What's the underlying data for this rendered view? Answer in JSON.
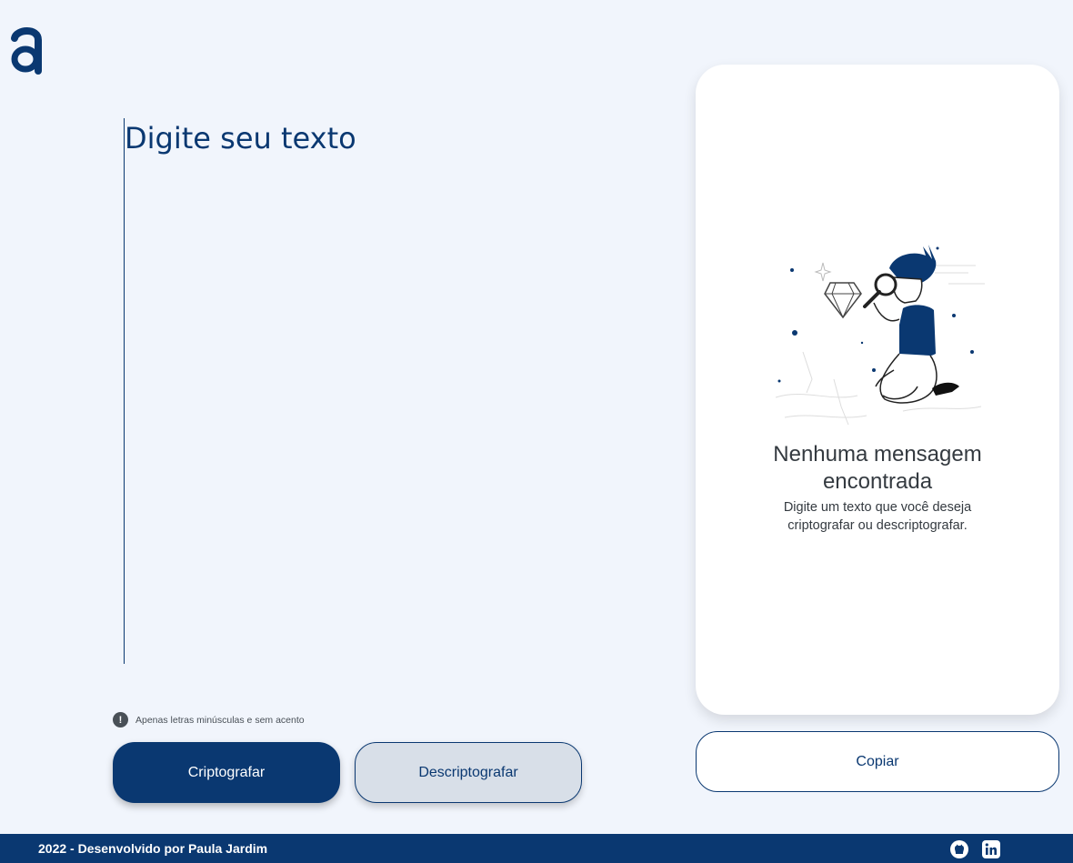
{
  "logo": {
    "icon": "alura-logo-icon",
    "letter": "a"
  },
  "input": {
    "placeholder": "Digite seu texto",
    "value": ""
  },
  "hint": {
    "icon": "exclamation-icon",
    "text": "Apenas letras minúsculas e sem acento"
  },
  "buttons": {
    "encrypt_label": "Criptografar",
    "decrypt_label": "Descriptografar",
    "copy_label": "Copiar"
  },
  "output": {
    "illustration": "boy-with-magnifying-glass-illustration",
    "title": "Nenhuma mensagem encontrada",
    "description": "Digite um texto que você deseja criptografar ou descriptografar."
  },
  "footer": {
    "text": "2022 - Desenvolvido por Paula Jardim",
    "links": [
      {
        "icon": "github-icon"
      },
      {
        "icon": "linkedin-icon"
      }
    ]
  },
  "colors": {
    "background": "#f1f5fc",
    "primary": "#0a3871",
    "secondary_button": "#d8dfe8",
    "text_dark": "#343a40"
  }
}
